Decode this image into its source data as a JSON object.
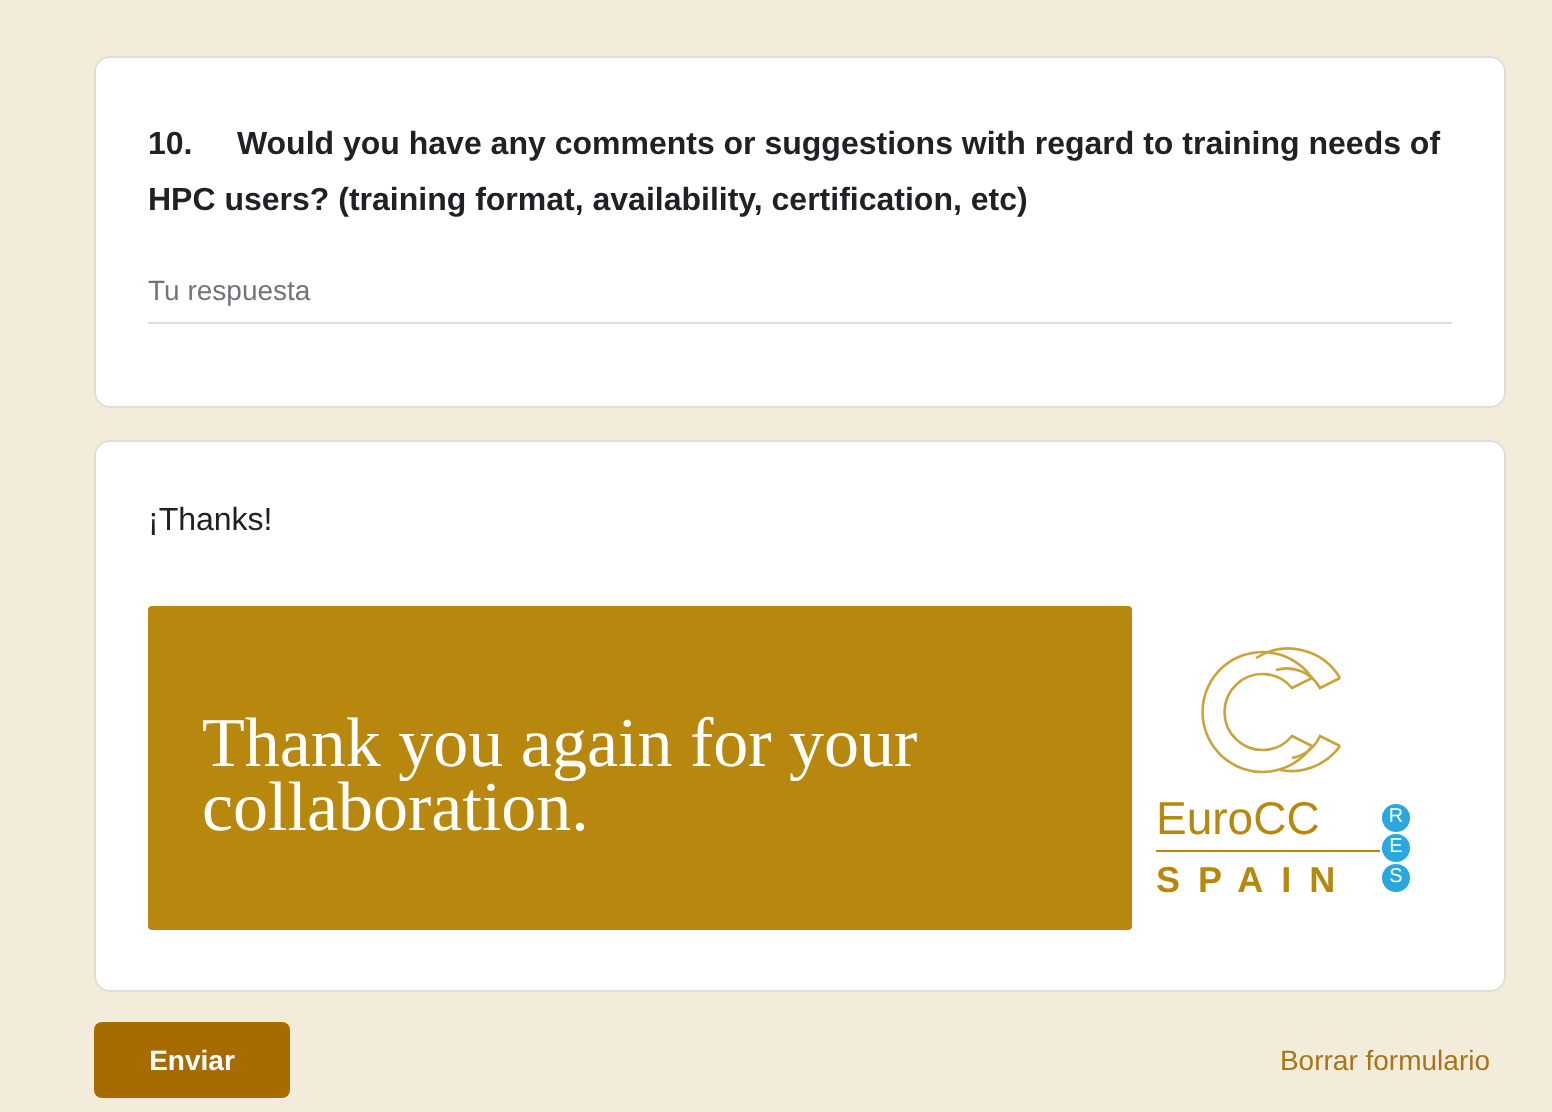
{
  "question": {
    "number": "10.",
    "text": "Would you have any comments or suggestions with regard to training needs of HPC users? (training format, availability, certification, etc)",
    "answer": {
      "placeholder": "Tu respuesta"
    }
  },
  "closing": {
    "title": "¡Thanks!",
    "banner": {
      "text": "Thank you again for your collaboration.",
      "logo": {
        "name": "EuroCC",
        "country": "SPAIN",
        "badge": [
          "R",
          "E",
          "S"
        ]
      }
    }
  },
  "buttons": {
    "submit": "Enviar",
    "clear": "Borrar formulario"
  }
}
